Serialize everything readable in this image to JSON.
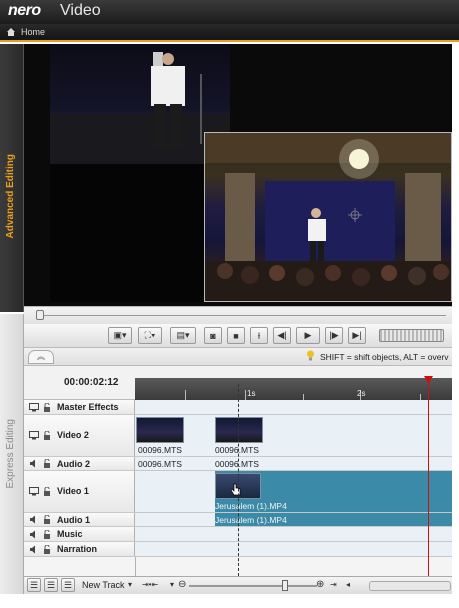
{
  "app": {
    "brand": "nero",
    "title": "Video"
  },
  "nav": {
    "home_label": "Home"
  },
  "side_tabs": {
    "advanced": "Advanced Editing",
    "express": "Express Editing"
  },
  "hint": {
    "text": "SHIFT = shift objects, ALT = overv"
  },
  "timeline": {
    "timecode": "00:00:02:12",
    "ruler_labels": [
      "1s",
      "2s"
    ],
    "tracks": [
      {
        "name": "Master Effects"
      },
      {
        "name": "Video 2"
      },
      {
        "name": "Audio 2"
      },
      {
        "name": "Video 1"
      },
      {
        "name": "Audio 1"
      },
      {
        "name": "Music"
      },
      {
        "name": "Narration"
      }
    ],
    "clips": {
      "video2_a": "00096.MTS",
      "video2_b": "00096.MTS",
      "audio2_a": "00096.MTS",
      "audio2_b": "00096.MTS",
      "video1": "Jerusalem (1).MP4",
      "audio1": "Jerusalem (1).MP4"
    }
  },
  "bottom": {
    "new_track_label": "New Track"
  },
  "colors": {
    "accent": "#e8a020",
    "playhead": "#cc1111",
    "track_bg": "#e9f1f7",
    "selected_track": "#3a8aa8"
  }
}
